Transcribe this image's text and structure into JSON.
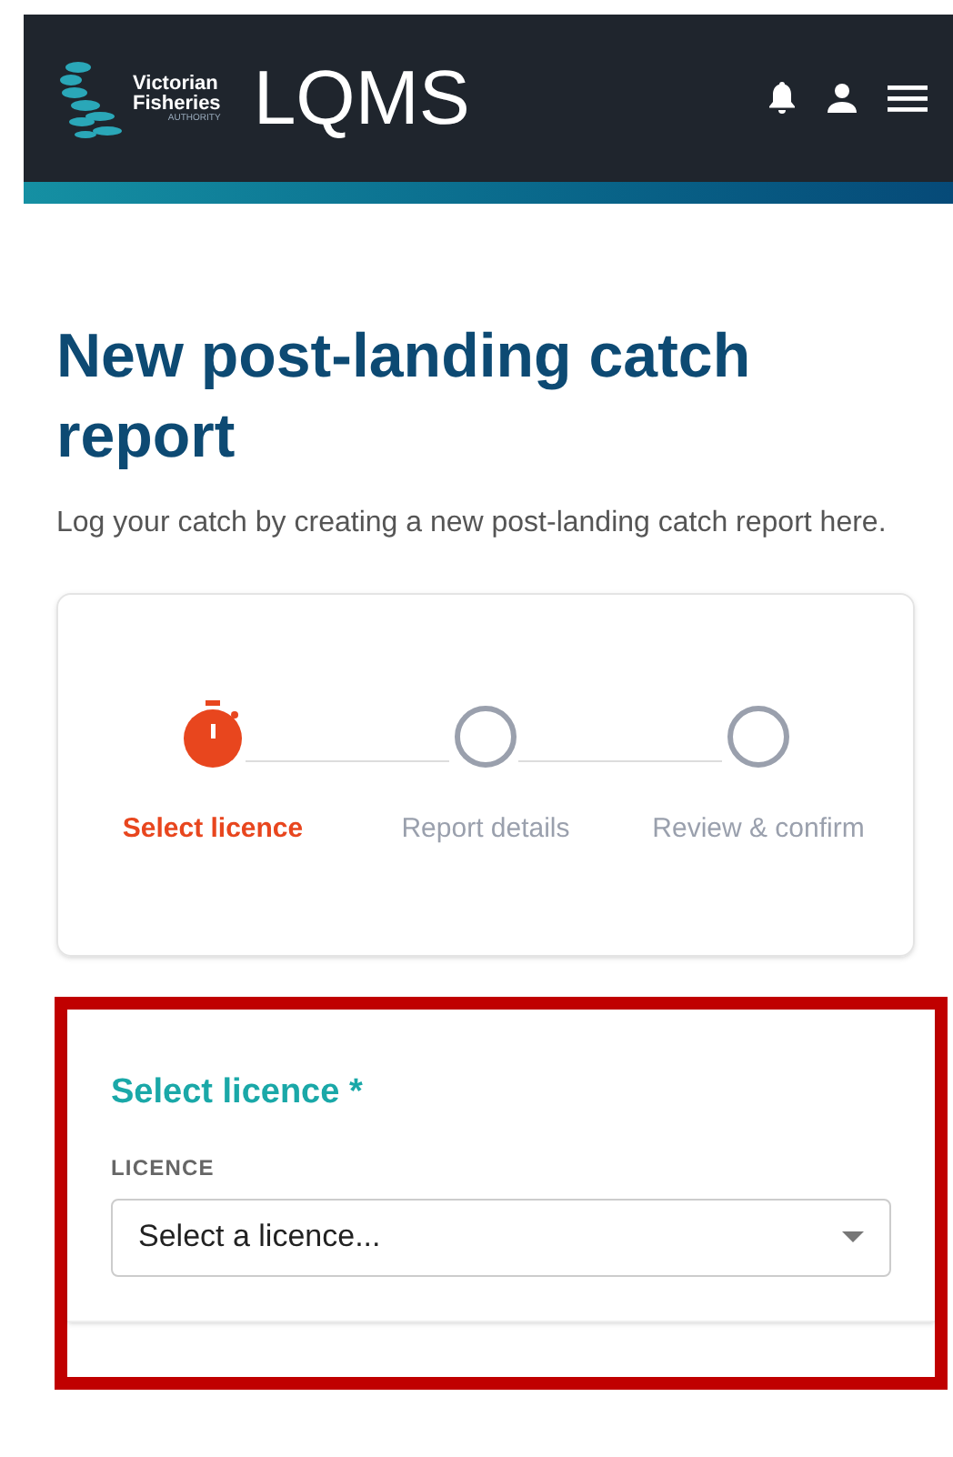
{
  "header": {
    "logo_lines": [
      "Victorian",
      "Fisheries",
      "AUTHORITY"
    ],
    "app_name": "LQMS"
  },
  "page": {
    "title": "New post-landing catch report",
    "subtitle": "Log your catch by creating a new post-landing catch report here."
  },
  "steps": [
    {
      "label": "Select licence",
      "selected": true
    },
    {
      "label": "Report details",
      "selected": false
    },
    {
      "label": "Review & confirm",
      "selected": false
    }
  ],
  "section": {
    "title": "Select licence *",
    "highlighted": true,
    "field": {
      "label": "LICENCE",
      "placeholder": "Select a licence..."
    }
  }
}
